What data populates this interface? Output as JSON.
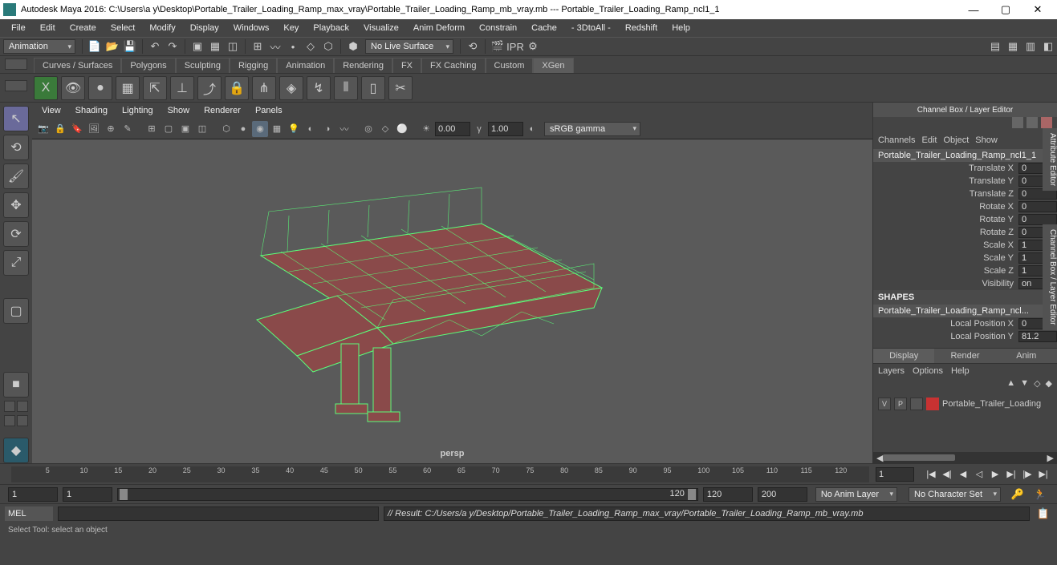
{
  "title": "Autodesk Maya 2016: C:\\Users\\a y\\Desktop\\Portable_Trailer_Loading_Ramp_max_vray\\Portable_Trailer_Loading_Ramp_mb_vray.mb  ---  Portable_Trailer_Loading_Ramp_ncl1_1",
  "menus": [
    "File",
    "Edit",
    "Create",
    "Select",
    "Modify",
    "Display",
    "Windows",
    "Key",
    "Playback",
    "Visualize",
    "Anim Deform",
    "Constrain",
    "Cache",
    "- 3DtoAll -",
    "Redshift",
    "Help"
  ],
  "workspace": "Animation",
  "live_surface": "No Live Surface",
  "shelf_tabs": [
    "Curves / Surfaces",
    "Polygons",
    "Sculpting",
    "Rigging",
    "Animation",
    "Rendering",
    "FX",
    "FX Caching",
    "Custom",
    "XGen"
  ],
  "shelf_active": "XGen",
  "panel_menus": [
    "View",
    "Shading",
    "Lighting",
    "Show",
    "Renderer",
    "Panels"
  ],
  "exposure": "0.00",
  "gamma": "1.00",
  "color_space": "sRGB gamma",
  "persp_label": "persp",
  "channel_box_title": "Channel Box / Layer Editor",
  "channel_tabs": [
    "Channels",
    "Edit",
    "Object",
    "Show"
  ],
  "object_name": "Portable_Trailer_Loading_Ramp_ncl1_1",
  "attrs": [
    {
      "l": "Translate X",
      "v": "0"
    },
    {
      "l": "Translate Y",
      "v": "0"
    },
    {
      "l": "Translate Z",
      "v": "0"
    },
    {
      "l": "Rotate X",
      "v": "0"
    },
    {
      "l": "Rotate Y",
      "v": "0"
    },
    {
      "l": "Rotate Z",
      "v": "0"
    },
    {
      "l": "Scale X",
      "v": "1"
    },
    {
      "l": "Scale Y",
      "v": "1"
    },
    {
      "l": "Scale Z",
      "v": "1"
    },
    {
      "l": "Visibility",
      "v": "on"
    }
  ],
  "shapes_label": "SHAPES",
  "shape_name": "Portable_Trailer_Loading_Ramp_ncl...",
  "shape_attrs": [
    {
      "l": "Local Position X",
      "v": "0"
    },
    {
      "l": "Local Position Y",
      "v": "81.2"
    }
  ],
  "layer_tabs": [
    "Display",
    "Render",
    "Anim"
  ],
  "layer_menu": [
    "Layers",
    "Options",
    "Help"
  ],
  "layer_name": "Portable_Trailer_Loading",
  "layer_v": "V",
  "layer_p": "P",
  "vert_tab1": "Attribute Editor",
  "vert_tab2": "Channel Box / Layer Editor",
  "time_ticks": [
    "5",
    "10",
    "15",
    "20",
    "25",
    "30",
    "35",
    "40",
    "45",
    "50",
    "55",
    "60",
    "65",
    "70",
    "75",
    "80",
    "85",
    "90",
    "95",
    "100",
    "105",
    "110",
    "115",
    "120"
  ],
  "time_current": "1",
  "range": {
    "start": "1",
    "inner_start": "1",
    "inner_end": "120",
    "end": "200",
    "label": "120"
  },
  "anim_layer": "No Anim Layer",
  "char_set": "No Character Set",
  "cmd_lang": "MEL",
  "cmd_result": "// Result: C:/Users/a y/Desktop/Portable_Trailer_Loading_Ramp_max_vray/Portable_Trailer_Loading_Ramp_mb_vray.mb",
  "help_line": "Select Tool: select an object"
}
